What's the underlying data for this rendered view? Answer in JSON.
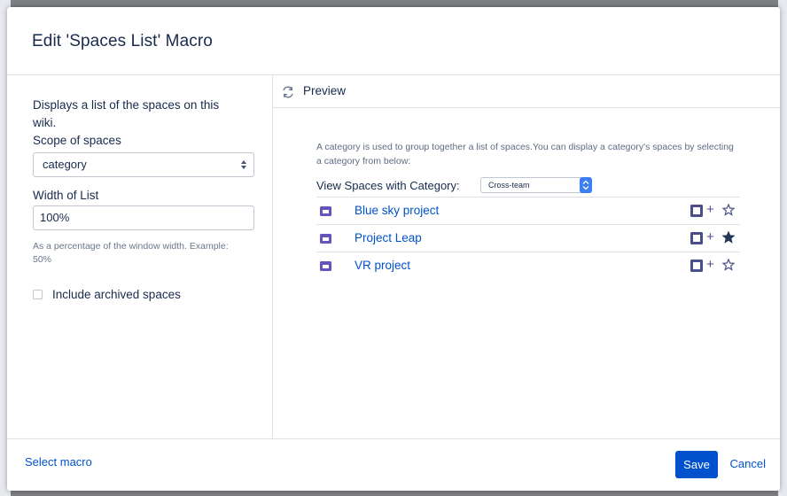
{
  "dialog": {
    "title": "Edit 'Spaces List' Macro"
  },
  "left_panel": {
    "description": "Displays a list of the spaces on this wiki.",
    "scope_label": "Scope of spaces",
    "scope_value": "category",
    "width_label": "Width of List",
    "width_value": "100%",
    "width_hint": "As a percentage of the window width. Example: 50%",
    "archived_label": "Include archived spaces",
    "archived_checked": false
  },
  "preview": {
    "title": "Preview",
    "info": "A category is used to group together a list of spaces.You can display a category's spaces by selecting a category from below:",
    "category_label": "View Spaces with Category:",
    "category_value": "Cross-team",
    "spaces": [
      {
        "name": "Blue sky project",
        "favourite": false
      },
      {
        "name": "Project Leap",
        "favourite": true
      },
      {
        "name": "VR project",
        "favourite": false
      }
    ]
  },
  "footer": {
    "select_macro": "Select macro",
    "save": "Save",
    "cancel": "Cancel"
  },
  "colors": {
    "accent": "#0052cc",
    "space_icon": "#6554c0",
    "action_icon": "#4a4f8a"
  },
  "icons": {
    "preview": "refresh-icon",
    "space": "space-icon",
    "add_to_watch": "plus-icon",
    "favourite": "star-icon"
  }
}
